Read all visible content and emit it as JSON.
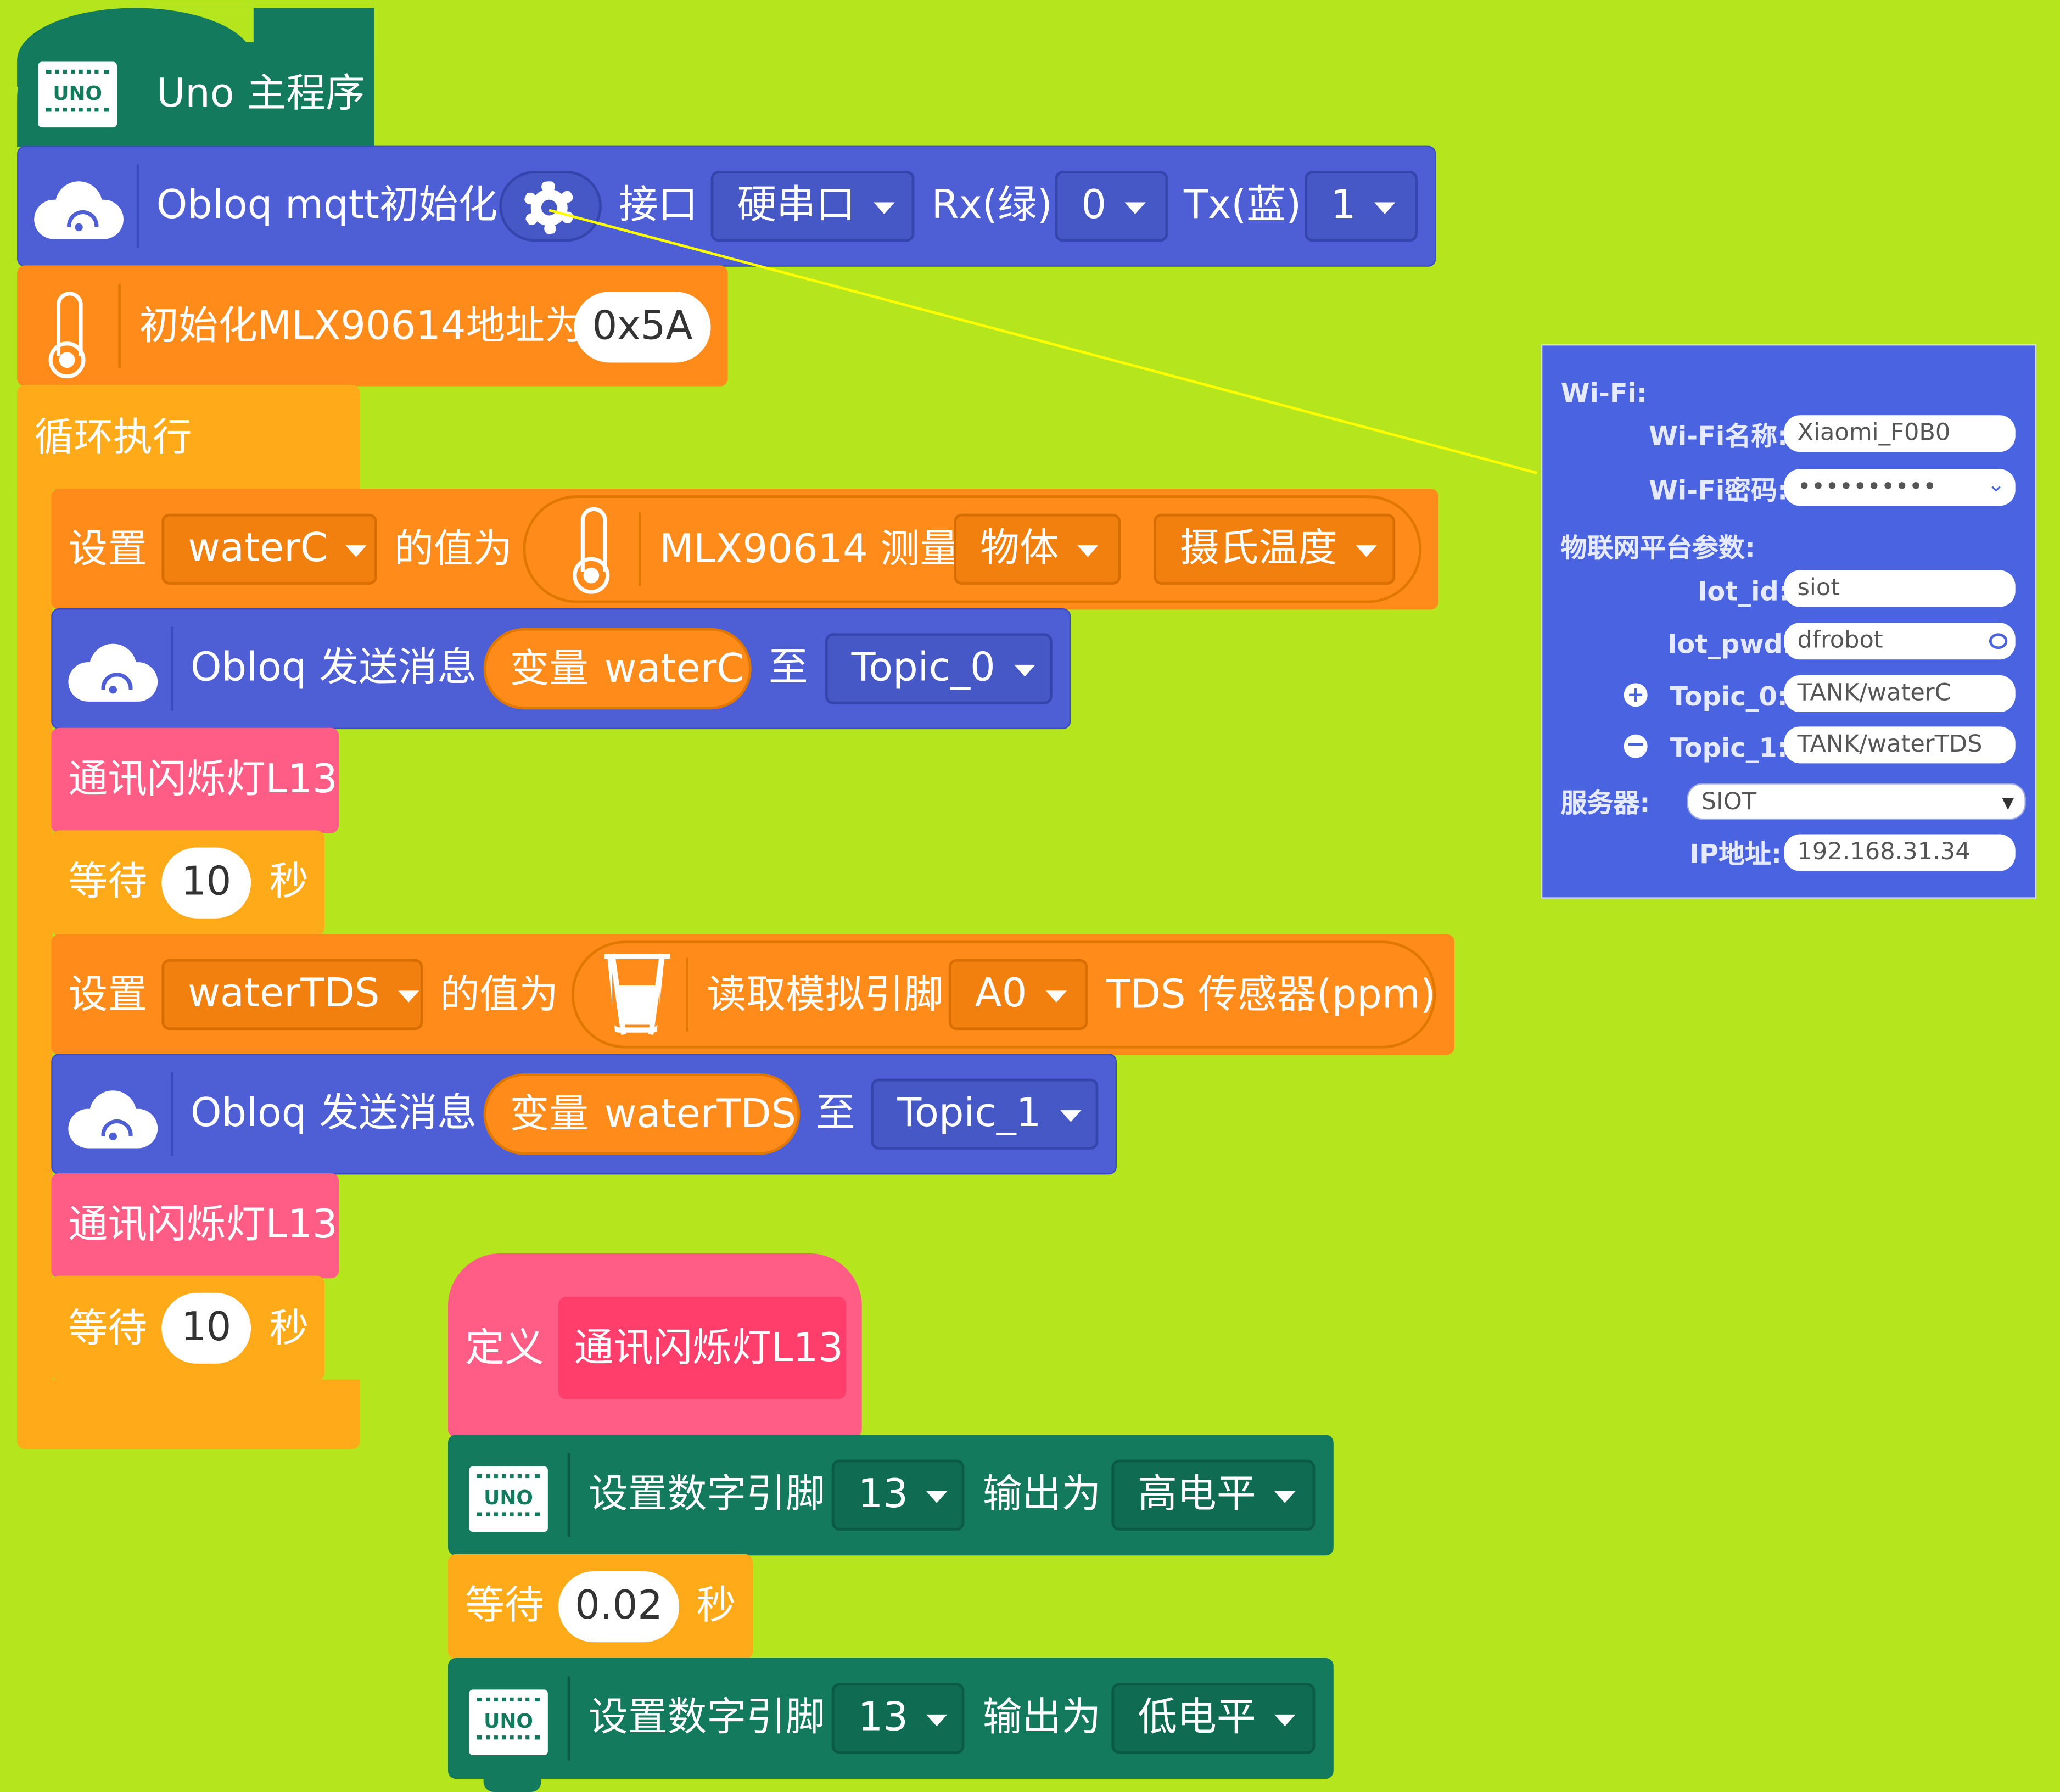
{
  "colors": {
    "workspace": "#b5e61d",
    "network": "#4e5fd6",
    "operator": "#ff8c1a",
    "control": "#ffab19",
    "function": "#ff5d86",
    "arduino": "#147a5e",
    "leader_line": "#ffff00"
  },
  "hat": {
    "label": "Uno 主程序",
    "icon": "uno-board-icon",
    "icon_text": "UNO"
  },
  "obloq_init": {
    "label": "Obloq mqtt初始化",
    "settings_icon": "gear-icon",
    "port_label": "接口",
    "port_value": "硬串口",
    "rx_label": "Rx(绿)",
    "rx_value": "0",
    "tx_label": "Tx(蓝)",
    "tx_value": "1"
  },
  "mlx_init": {
    "label": "初始化MLX90614地址为",
    "value": "0x5A",
    "icon": "thermometer-icon"
  },
  "loop": {
    "label": "循环执行"
  },
  "set_waterC": {
    "set_label": "设置",
    "var": "waterC",
    "value_label": "的值为",
    "sensor_label": "MLX90614 测量",
    "target": "物体",
    "unit": "摄氏温度"
  },
  "send_waterC": {
    "label": "Obloq 发送消息",
    "var_prefix": "变量",
    "var": "waterC",
    "to_label": "至",
    "topic": "Topic_0"
  },
  "call_led_1": {
    "label": "通讯闪烁灯L13"
  },
  "wait_1": {
    "label": "等待",
    "value": "10",
    "unit": "秒"
  },
  "set_waterTDS": {
    "set_label": "设置",
    "var": "waterTDS",
    "value_label": "的值为",
    "read_label": "读取模拟引脚",
    "pin": "A0",
    "sensor_label": "TDS 传感器(ppm)",
    "icon": "water-cup-icon"
  },
  "send_waterTDS": {
    "label": "Obloq 发送消息",
    "var_prefix": "变量",
    "var": "waterTDS",
    "to_label": "至",
    "topic": "Topic_1"
  },
  "call_led_2": {
    "label": "通讯闪烁灯L13"
  },
  "wait_2": {
    "label": "等待",
    "value": "10",
    "unit": "秒"
  },
  "define": {
    "label": "定义",
    "name": "通讯闪烁灯L13"
  },
  "pin_high": {
    "label": "设置数字引脚",
    "pin": "13",
    "output_label": "输出为",
    "level": "高电平",
    "icon_text": "UNO"
  },
  "wait_3": {
    "label": "等待",
    "value": "0.02",
    "unit": "秒"
  },
  "pin_low": {
    "label": "设置数字引脚",
    "pin": "13",
    "output_label": "输出为",
    "level": "低电平",
    "icon_text": "UNO"
  },
  "panel": {
    "wifi_header": "Wi-Fi:",
    "ssid_label": "Wi-Fi名称:",
    "ssid_value": "Xiaomi_F0B0",
    "pwd_label": "Wi-Fi密码:",
    "pwd_value": "••••••••••",
    "iot_header": "物联网平台参数:",
    "iot_id_label": "Iot_id:",
    "iot_id_value": "siot",
    "iot_pwd_label": "Iot_pwd:",
    "iot_pwd_value": "dfrobot",
    "topic0_label": "Topic_0:",
    "topic0_value": "TANK/waterC",
    "topic1_label": "Topic_1:",
    "topic1_value": "TANK/waterTDS",
    "server_label": "服务器:",
    "server_value": "SIOT",
    "ip_label": "IP地址:",
    "ip_value": "192.168.31.34"
  }
}
